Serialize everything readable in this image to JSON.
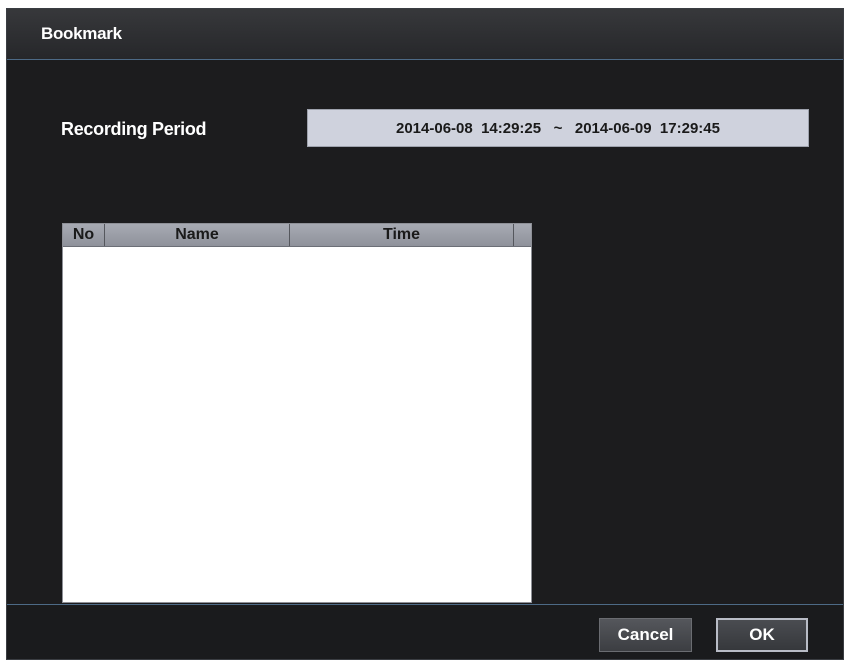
{
  "dialog": {
    "title": "Bookmark"
  },
  "recording_period": {
    "label": "Recording Period",
    "value": "2014-06-08  14:29:25   ~   2014-06-09  17:29:45"
  },
  "bookmark_table": {
    "columns": [
      "No",
      "Name",
      "Time",
      ""
    ],
    "rows": []
  },
  "footer": {
    "cancel_label": "Cancel",
    "ok_label": "OK"
  }
}
